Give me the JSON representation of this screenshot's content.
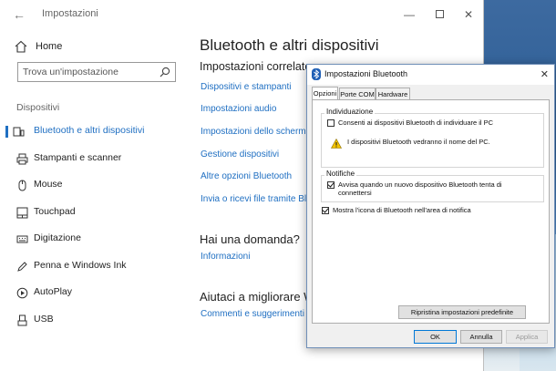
{
  "window": {
    "title": "Impostazioni",
    "back_icon": "back-arrow-icon",
    "controls": [
      "minimize-icon",
      "maximize-icon",
      "close-icon"
    ]
  },
  "sidebar": {
    "home_label": "Home",
    "search_placeholder": "Trova un'impostazione",
    "section_label": "Dispositivi",
    "items": [
      {
        "label": "Bluetooth e altri dispositivi",
        "icon": "bluetooth-devices-icon",
        "active": true
      },
      {
        "label": "Stampanti e scanner",
        "icon": "printer-icon",
        "active": false
      },
      {
        "label": "Mouse",
        "icon": "mouse-icon",
        "active": false
      },
      {
        "label": "Touchpad",
        "icon": "touchpad-icon",
        "active": false
      },
      {
        "label": "Digitazione",
        "icon": "keyboard-icon",
        "active": false
      },
      {
        "label": "Penna e Windows Ink",
        "icon": "pen-icon",
        "active": false
      },
      {
        "label": "AutoPlay",
        "icon": "autoplay-icon",
        "active": false
      },
      {
        "label": "USB",
        "icon": "usb-icon",
        "active": false
      }
    ]
  },
  "main": {
    "title": "Bluetooth e altri dispositivi",
    "related_title": "Impostazioni correlate",
    "related_links": [
      "Dispositivi e stampanti",
      "Impostazioni audio",
      "Impostazioni dello schermo",
      "Gestione dispositivi",
      "Altre opzioni Bluetooth",
      "Invia o ricevi file tramite Blue"
    ],
    "question_title": "Hai una domanda?",
    "question_link": "Informazioni",
    "improve_title": "Aiutaci a migliorare W",
    "improve_link": "Commenti e suggerimenti"
  },
  "dialog": {
    "title": "Impostazioni Bluetooth",
    "icon": "bluetooth-icon",
    "tabs": [
      {
        "label": "Opzioni",
        "active": true
      },
      {
        "label": "Porte COM",
        "active": false
      },
      {
        "label": "Hardware",
        "active": false
      }
    ],
    "discovery": {
      "label": "Individuazione",
      "allow_label": "Consenti ai dispositivi Bluetooth di individuare il PC",
      "allow_checked": false,
      "warning_text": "I dispositivi Bluetooth vedranno il nome del PC.",
      "warning_icon": "warning-icon"
    },
    "notifications": {
      "label": "Notifiche",
      "alert_label_line1": "Avvisa quando un nuovo dispositivo Bluetooth tenta di",
      "alert_label_line2": "connettersi",
      "alert_checked": true
    },
    "show_icon_label": "Mostra l'icona di Bluetooth nell'area di notifica",
    "show_icon_checked": true,
    "restore_button": "Ripristina impostazioni predefinite",
    "ok_button": "OK",
    "cancel_button": "Annulla",
    "apply_button": "Applica"
  }
}
